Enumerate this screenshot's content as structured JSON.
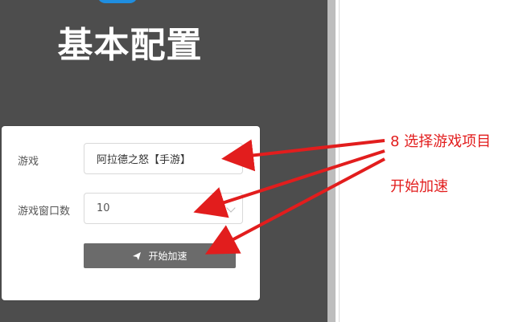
{
  "header": {
    "title": "基本配置"
  },
  "form": {
    "game_label": "游戏",
    "game_value": "阿拉德之怒【手游】",
    "windows_label": "游戏窗口数",
    "windows_value": "10",
    "start_button_label": "开始加速",
    "start_icon": "send-icon"
  },
  "annotations": {
    "step_text": "8 选择游戏项目",
    "start_text": "开始加速",
    "color": "#e21d1d"
  },
  "colors": {
    "panel_bg": "#4d4d4d",
    "button_bg": "#6b6b6b",
    "accent_blue": "#1f8ee0"
  }
}
